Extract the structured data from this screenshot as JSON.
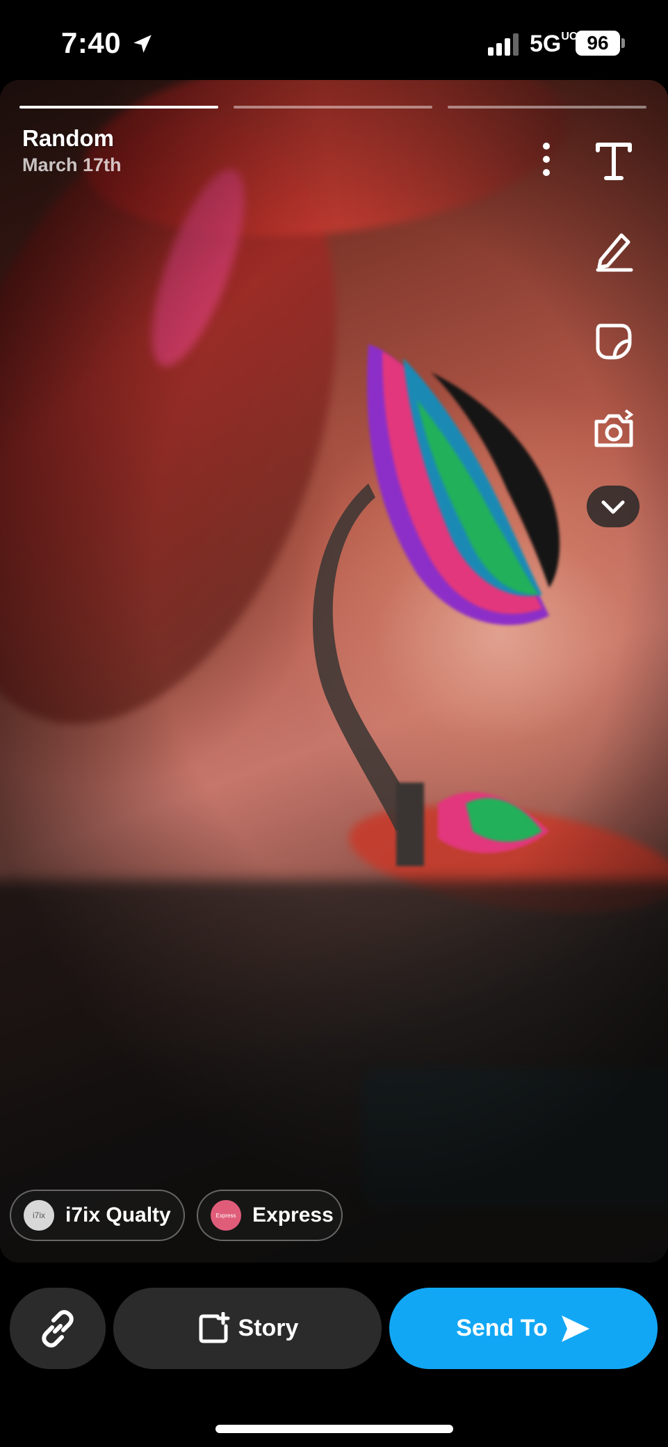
{
  "status_bar": {
    "time": "7:40",
    "network": "5G",
    "network_sup": "UC",
    "battery": "96"
  },
  "story": {
    "title": "Random",
    "date": "March 17th",
    "segments": 3,
    "active_segment": 1
  },
  "tools": [
    "text-icon",
    "pencil-icon",
    "sticker-icon",
    "camera-flip-icon",
    "chevron-down-icon"
  ],
  "chips": [
    {
      "label": "i7ix Qualty",
      "avatar_text": "i7ix"
    },
    {
      "label": "Express",
      "avatar_text": "Express"
    }
  ],
  "buttons": {
    "story": "Story",
    "send": "Send To"
  },
  "colors": {
    "send_blue": "#12a7f5",
    "button_dark": "#2b2b2b"
  }
}
